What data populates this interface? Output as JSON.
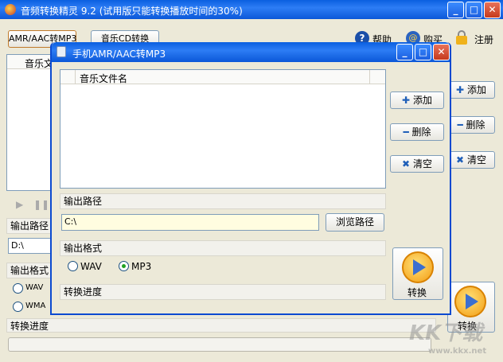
{
  "main": {
    "title": "音频转换精灵 9.2 (试用版只能转换播放时间的30%)",
    "tabs": [
      "AMR/AAC转MP3",
      "音乐CD转换"
    ],
    "links": {
      "help": "帮助",
      "buy": "购买",
      "register": "注册"
    },
    "list_header": "音乐文",
    "buttons": {
      "add": "添加",
      "delete": "删除",
      "clear": "清空",
      "convert": "转换"
    },
    "output_path_label": "输出路径",
    "output_path_value": "D:\\",
    "output_format_label": "输出格式",
    "formats": [
      "WAV",
      "WMA"
    ],
    "progress_label": "转换进度"
  },
  "dialog": {
    "title": "手机AMR/AAC转MP3",
    "list_header": "音乐文件名",
    "buttons": {
      "add": "添加",
      "delete": "删除",
      "clear": "清空",
      "browse": "浏览路径",
      "convert": "转换"
    },
    "output_path_label": "输出路径",
    "output_path_value": "C:\\",
    "output_format_label": "输出格式",
    "formats": [
      "WAV",
      "MP3"
    ],
    "selected_format": "MP3",
    "progress_label": "转换进度"
  },
  "watermark": {
    "text": "KK下载",
    "url": "www.kkx.net"
  },
  "colors": {
    "titlebar": "#0b57d8",
    "path_field": "#fffde0",
    "accent_orange": "#f7a81b"
  }
}
